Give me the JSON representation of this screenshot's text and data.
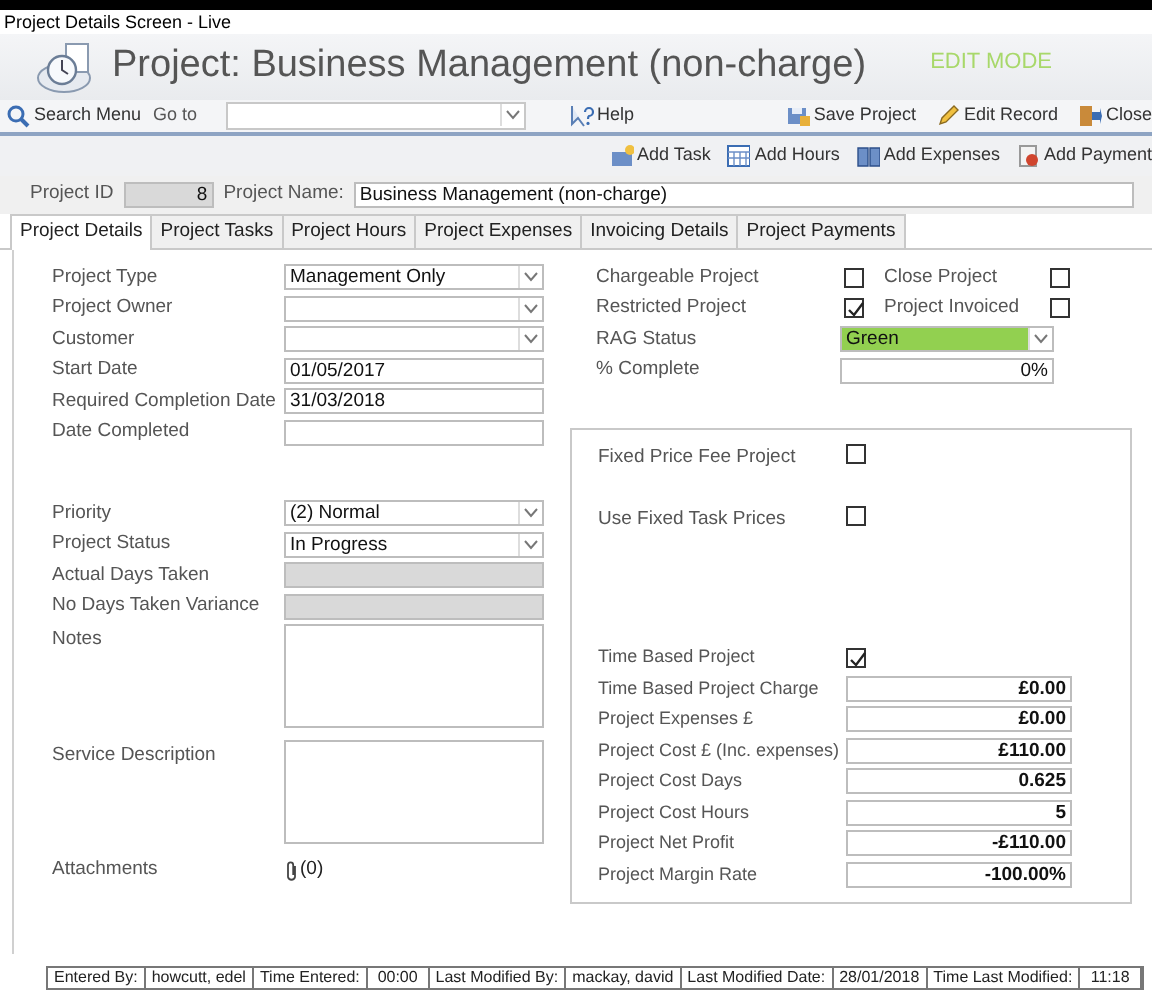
{
  "window": {
    "title": "Project Details Screen - Live"
  },
  "header": {
    "title": "Project: Business Management (non-charge)",
    "mode": "EDIT MODE"
  },
  "toolbar": [
    {
      "kind": "search",
      "label": "Search Menu"
    },
    {
      "kind": "label",
      "label": "Go to"
    },
    {
      "kind": "combo"
    },
    {
      "kind": "help",
      "label": "Help"
    },
    {
      "kind": "save",
      "label": "Save Project"
    },
    {
      "kind": "edit",
      "label": "Edit Record"
    },
    {
      "kind": "close",
      "label": "Close"
    }
  ],
  "actions": [
    {
      "kind": "task",
      "label": "Add Task"
    },
    {
      "kind": "hours",
      "label": "Add Hours"
    },
    {
      "kind": "expenses",
      "label": "Add Expenses"
    },
    {
      "kind": "payment",
      "label": "Add Payment"
    }
  ],
  "project": {
    "id_label": "Project ID",
    "id": "8",
    "name_label": "Project Name:",
    "name": "Business Management (non-charge)"
  },
  "tabs": [
    {
      "label": "Project Details",
      "selected": true
    },
    {
      "label": "Project Tasks",
      "selected": false
    },
    {
      "label": "Project Hours",
      "selected": false
    },
    {
      "label": "Project Expenses",
      "selected": false
    },
    {
      "label": "Invoicing Details",
      "selected": false
    },
    {
      "label": "Project Payments",
      "selected": false
    }
  ],
  "left_sections": [
    [
      {
        "kind": "dropdown",
        "label": "Project Type",
        "value": "Management Only"
      },
      {
        "kind": "dropdown",
        "label": "Project Owner"
      },
      {
        "kind": "dropdown",
        "label": "Customer"
      },
      {
        "kind": "text",
        "label": "Start Date",
        "value": "01/05/2017"
      },
      {
        "kind": "text",
        "label": "Required Completion Date",
        "value": "31/03/2018"
      },
      {
        "kind": "text",
        "label": "Date Completed"
      }
    ],
    [
      {
        "kind": "dropdown",
        "label": "Priority",
        "value": "(2) Normal"
      },
      {
        "kind": "dropdown",
        "label": "Project Status",
        "value": "In Progress"
      },
      {
        "kind": "locked",
        "label": "Actual Days Taken"
      },
      {
        "kind": "locked",
        "label": "No Days Taken Variance"
      },
      {
        "kind": "memo",
        "label": "Notes"
      },
      {
        "kind": "memo",
        "label": "Service Description"
      },
      {
        "kind": "attachment",
        "label": "Attachments",
        "value": "(0)"
      }
    ]
  ],
  "flags": [
    {
      "label": "Chargeable Project",
      "checked": false
    },
    {
      "label": "Close Project",
      "checked": false
    },
    {
      "label": "Restricted Project",
      "checked": true
    },
    {
      "label": "Project Invoiced",
      "checked": false
    }
  ],
  "rag_status": {
    "label": "RAG Status",
    "value": "Green",
    "color": "#92d050"
  },
  "percent_complete": {
    "label": "% Complete",
    "value": "0%"
  },
  "panel": {
    "sections": [
      {
        "kind": "options",
        "items": [
          {
            "kind": "check",
            "label": "Fixed Price Fee Project",
            "checked": false
          },
          {
            "kind": "check",
            "label": "Use Fixed Task Prices",
            "checked": false
          }
        ]
      },
      {
        "kind": "figures",
        "items": [
          {
            "kind": "check",
            "label": "Time Based Project",
            "checked": true
          },
          {
            "kind": "amount",
            "label": "Time Based Project Charge",
            "value": "£0.00"
          },
          {
            "kind": "amount",
            "label": "Project Expenses £",
            "value": "£0.00"
          },
          {
            "kind": "amount",
            "label": "Project Cost £ (Inc. expenses)",
            "value": "£110.00"
          },
          {
            "kind": "amount",
            "label": "Project Cost Days",
            "value": "0.625"
          },
          {
            "kind": "amount",
            "label": "Project Cost Hours",
            "value": "5"
          },
          {
            "kind": "amount",
            "label": "Project Net Profit",
            "value": "-£110.00"
          },
          {
            "kind": "amount",
            "label": "Project Margin Rate",
            "value": "-100.00%"
          }
        ]
      }
    ]
  },
  "status_bar": [
    {
      "label": "Entered By:",
      "value": "howcutt, edel"
    },
    {
      "label": "Time Entered:",
      "value": "00:00"
    },
    {
      "label": "Last Modified By:",
      "value": "mackay, david"
    },
    {
      "label": "Last Modified Date:",
      "value": "28/01/2018"
    },
    {
      "label": "Time Last Modified:",
      "value": "11:18"
    }
  ]
}
